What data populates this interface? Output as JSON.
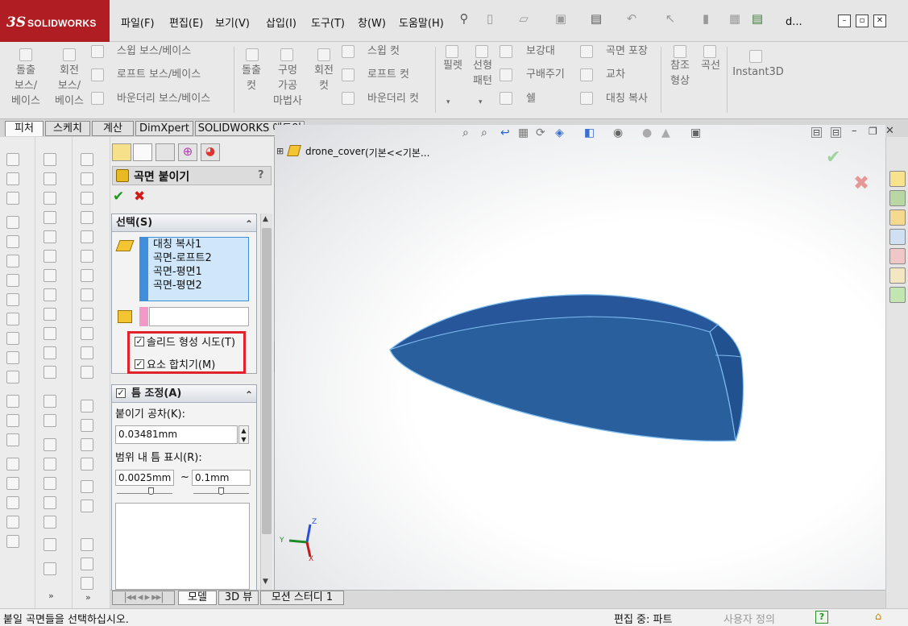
{
  "app": {
    "logo_ds": "3S",
    "logo_text": "SOLIDWORKS"
  },
  "menu": [
    "파일(F)",
    "편집(E)",
    "보기(V)",
    "삽입(I)",
    "도구(T)",
    "창(W)",
    "도움말(H)"
  ],
  "window_title": "d...",
  "ribbon": {
    "extrude_boss": "돌출\n보스/\n베이스",
    "revolve_boss": "회전\n보스/\n베이스",
    "sweep_boss": "스윕 보스/베이스",
    "loft_boss": "로프트 보스/베이스",
    "boundary_boss": "바운더리 보스/베이스",
    "extrude_cut": "돌출\n컷",
    "hole_wizard": "구멍\n가공\n마법사",
    "revolve_cut": "회전\n컷",
    "sweep_cut": "스윕 컷",
    "loft_cut": "로프트 컷",
    "boundary_cut": "바운더리 컷",
    "fillet": "필렛",
    "linear_pattern": "선형\n패턴",
    "rib": "보강대",
    "draft": "구배주기",
    "shell": "쉘",
    "wrap": "곡면 포장",
    "intersect": "교차",
    "mirror": "대칭 복사",
    "ref_geometry": "참조\n형상",
    "curves": "곡선",
    "instant3d": "Instant3D"
  },
  "command_tabs": [
    "피처",
    "스케치",
    "계산",
    "DimXpert",
    "SOLIDWORKS 애드인"
  ],
  "feature_tree": {
    "root": "drone_cover",
    "config": "(기본<<기본..."
  },
  "property_manager": {
    "title": "곡면 붙이기",
    "help": "?",
    "selection": {
      "header": "선택(S)",
      "items": [
        "대칭 복사1",
        "곡면-로프트2",
        "곡면-평면1",
        "곡면-평면2"
      ],
      "try_solid_label": "솔리드 형성 시도(T)",
      "try_solid_checked": true,
      "merge_entities_label": "요소 합치기(M)",
      "merge_entities_checked": true
    },
    "gap_control": {
      "header": "틈 조정(A)",
      "checked": true,
      "tolerance_label": "붙이기 공차(K):",
      "tolerance_value": "0.03481mm",
      "range_label": "범위 내 틈 표시(R):",
      "range_min": "0.0025mm",
      "range_sep": "~",
      "range_max": "0.1mm"
    }
  },
  "bottom_tabs": [
    "모델",
    "3D 뷰",
    "모션 스터디 1"
  ],
  "status": {
    "message": "붙일 곡면들을 선택하십시오.",
    "mode": "편집 중: 파트",
    "units": "사용자 정의",
    "help_icon": "?"
  },
  "triad": {
    "x": "X",
    "y": "Y",
    "z": "Z"
  },
  "colors": {
    "brand": "#b01e23",
    "body": "#2a5f9e",
    "selection": "#cfe6fb",
    "highlight_red": "#e0222a"
  }
}
